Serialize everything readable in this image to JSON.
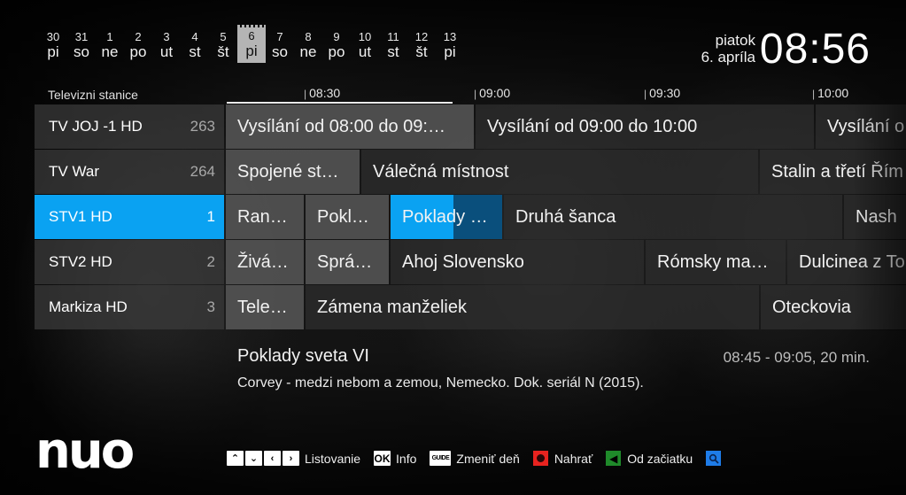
{
  "date_strip": [
    {
      "num": "30",
      "dow": "pi",
      "selected": false
    },
    {
      "num": "31",
      "dow": "so",
      "selected": false
    },
    {
      "num": "1",
      "dow": "ne",
      "selected": false
    },
    {
      "num": "2",
      "dow": "po",
      "selected": false
    },
    {
      "num": "3",
      "dow": "ut",
      "selected": false
    },
    {
      "num": "4",
      "dow": "st",
      "selected": false
    },
    {
      "num": "5",
      "dow": "št",
      "selected": false
    },
    {
      "num": "6",
      "dow": "pi",
      "selected": true
    },
    {
      "num": "7",
      "dow": "so",
      "selected": false
    },
    {
      "num": "8",
      "dow": "ne",
      "selected": false
    },
    {
      "num": "9",
      "dow": "po",
      "selected": false
    },
    {
      "num": "10",
      "dow": "ut",
      "selected": false
    },
    {
      "num": "11",
      "dow": "st",
      "selected": false
    },
    {
      "num": "12",
      "dow": "št",
      "selected": false
    },
    {
      "num": "13",
      "dow": "pi",
      "selected": false
    }
  ],
  "clock": {
    "weekday": "piatok",
    "date": "6. apríla",
    "time": "08:56"
  },
  "timeline": {
    "stations_label": "Televizni stanice",
    "ticks": [
      "08:30",
      "09:00",
      "09:30",
      "10:00"
    ]
  },
  "channels": [
    {
      "name": "TV JOJ -1 HD",
      "number": "263",
      "active": false,
      "programs": [
        "Vysílání od 08:00 do 09:…",
        "Vysílání od 09:00 do 10:00",
        "Vysílání o"
      ]
    },
    {
      "name": "TV War",
      "number": "264",
      "active": false,
      "programs": [
        "Spojené st…",
        "Válečná místnost",
        "Stalin a třetí Řím"
      ]
    },
    {
      "name": "STV1 HD",
      "number": "1",
      "active": true,
      "programs": [
        "Ran…",
        "Pokl…",
        "Poklady …",
        "Druhá šanca",
        "Nash"
      ]
    },
    {
      "name": "STV2 HD",
      "number": "2",
      "active": false,
      "programs": [
        "Živá…",
        "Sprá…",
        "Ahoj Slovensko",
        "Rómsky ma…",
        "Dulcinea z To"
      ]
    },
    {
      "name": "Markiza HD",
      "number": "3",
      "active": false,
      "programs": [
        "Tele…",
        "Zámena manželiek",
        "Oteckovia"
      ]
    }
  ],
  "details": {
    "title": "Poklady sveta VI",
    "time": "08:45 - 09:05, 20 min.",
    "description": "Corvey - medzi nebom a zemou, Nemecko. Dok. seriál N (2015)."
  },
  "brand": {
    "logo": "nuo"
  },
  "hints": {
    "keys_up": "^",
    "keys_down": "v",
    "keys_left": "<",
    "keys_right": ">",
    "browse": "Listovanie",
    "ok_key": "OK",
    "info": "Info",
    "guide_key": "GUIDE",
    "change_day": "Zmeniť deň",
    "record": "Nahrať",
    "restart": "Od začiatku",
    "search_icon": "search"
  },
  "colors": {
    "accent": "#0aa2f2",
    "accent_future": "#0a4f7c",
    "record": "#e8231f",
    "restart": "#1f8a2a",
    "search": "#1e7ce8"
  }
}
